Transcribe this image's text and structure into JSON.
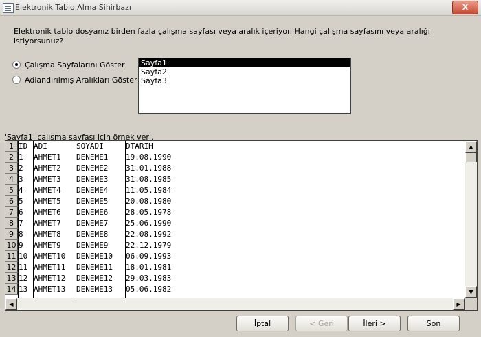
{
  "window": {
    "title": "Elektronik Tablo Alma Sihirbazı",
    "close_glyph": "X"
  },
  "intro": {
    "text": "Elektronik tablo dosyanız birden fazla çalışma sayfası veya aralık içeriyor. Hangi çalışma sayfasını veya aralığı istiyorsunuz?"
  },
  "options": [
    {
      "label": "Çalışma Sayfalarını Göster",
      "checked": true
    },
    {
      "label": "Adlandırılmış Aralıkları Göster",
      "checked": false
    }
  ],
  "sheets": [
    "Sayfa1",
    "Sayfa2",
    "Sayfa3"
  ],
  "selected_sheet": "Sayfa1",
  "sample": {
    "label": "'Sayfa1' çalışma sayfası için örnek veri.",
    "row_numbers": [
      "1",
      "2",
      "3",
      "4",
      "5",
      "6",
      "7",
      "8",
      "9",
      "10",
      "11",
      "12",
      "13",
      "14"
    ],
    "rows": [
      [
        "ID",
        "ADI",
        "SOYADI",
        "DTARIH"
      ],
      [
        "1",
        "AHMET1",
        "DENEME1",
        "19.08.1990"
      ],
      [
        "2",
        "AHMET2",
        "DENEME2",
        "31.01.1988"
      ],
      [
        "3",
        "AHMET3",
        "DENEME3",
        "31.08.1985"
      ],
      [
        "4",
        "AHMET4",
        "DENEME4",
        "11.05.1984"
      ],
      [
        "5",
        "AHMET5",
        "DENEME5",
        "20.08.1980"
      ],
      [
        "6",
        "AHMET6",
        "DENEME6",
        "28.05.1978"
      ],
      [
        "7",
        "AHMET7",
        "DENEME7",
        "25.06.1990"
      ],
      [
        "8",
        "AHMET8",
        "DENEME8",
        "22.08.1992"
      ],
      [
        "9",
        "AHMET9",
        "DENEME9",
        "22.12.1979"
      ],
      [
        "10",
        "AHMET10",
        "DENEME10",
        "06.09.1993"
      ],
      [
        "11",
        "AHMET11",
        "DENEME11",
        "18.01.1981"
      ],
      [
        "12",
        "AHMET12",
        "DENEME12",
        "29.03.1983"
      ],
      [
        "13",
        "AHMET13",
        "DENEME13",
        "05.06.1982"
      ]
    ]
  },
  "buttons": {
    "cancel": "İptal",
    "back": "< Geri",
    "next": "İleri >",
    "finish": "Son"
  },
  "icons": {
    "window": "window-icon",
    "scroll_up": "scroll-up-icon",
    "scroll_down": "scroll-down-icon",
    "scroll_left": "scroll-left-icon",
    "scroll_right": "scroll-right-icon"
  }
}
